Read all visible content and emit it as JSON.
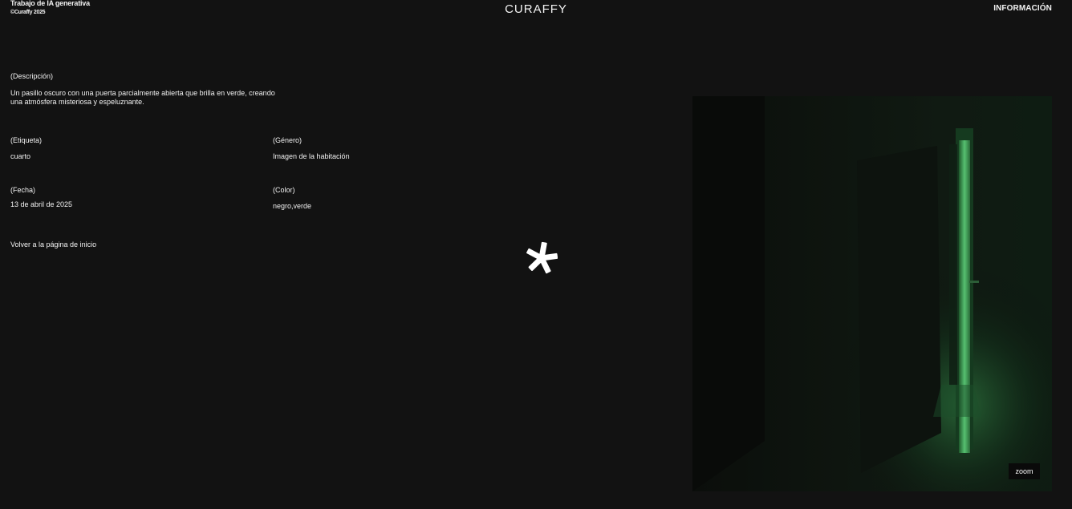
{
  "header": {
    "brand_line1": "Trabajo de IA generativa",
    "brand_line2": "©Curaffy 2025",
    "logo": "CURAFFY",
    "nav_info": "INFORMACIÓN"
  },
  "details": {
    "description_label": "(Descripción)",
    "description_text": "Un pasillo oscuro con una puerta parcialmente abierta que brilla en verde, creando una atmósfera misteriosa y espeluznante.",
    "tag_label": "(Etiqueta)",
    "tag_value": "cuarto",
    "genre_label": "(Género)",
    "genre_value": "Imagen de la habitación",
    "date_label": "(Fecha)",
    "date_value": "13 de abril de 2025",
    "color_label": "(Color)",
    "color_value": "negro,verde",
    "back_link": "Volver a la página de inicio"
  },
  "image": {
    "zoom_label": "zoom"
  },
  "icons": {
    "center": "asterisk-icon"
  },
  "colors": {
    "background": "#121212",
    "text": "#f2f2f2",
    "glow": "#3fae5c"
  }
}
